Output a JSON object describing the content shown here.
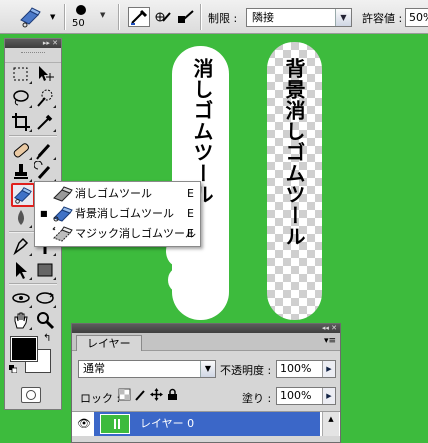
{
  "options_bar": {
    "brush_size": "50",
    "limit_label": "制限 :",
    "limit_value": "隣接",
    "tolerance_label": "許容値 :",
    "tolerance_value": "50%"
  },
  "tools_panel": {
    "title_icons": "▸▸ ✕"
  },
  "flyout": {
    "items": [
      {
        "label": "消しゴムツール",
        "shortcut": "E",
        "active": false,
        "icon": "eraser-icon"
      },
      {
        "label": "背景消しゴムツール",
        "shortcut": "E",
        "active": true,
        "icon": "background-eraser-icon"
      },
      {
        "label": "マジック消しゴムツール",
        "shortcut": "E",
        "active": false,
        "icon": "magic-eraser-icon"
      }
    ]
  },
  "canvas": {
    "text_left": "消しゴムツール",
    "text_right": "背景消しゴムツール",
    "background_color": "#3dbb3d"
  },
  "layers_panel": {
    "title_icons": "◂◂ ✕",
    "tab_label": "レイヤー",
    "blend_mode": "通常",
    "opacity_label": "不透明度 :",
    "opacity_value": "100%",
    "lock_label": "ロック :",
    "fill_label": "塗り :",
    "fill_value": "100%",
    "layer_name": "レイヤー 0",
    "selected_color": "#3b67c8"
  }
}
